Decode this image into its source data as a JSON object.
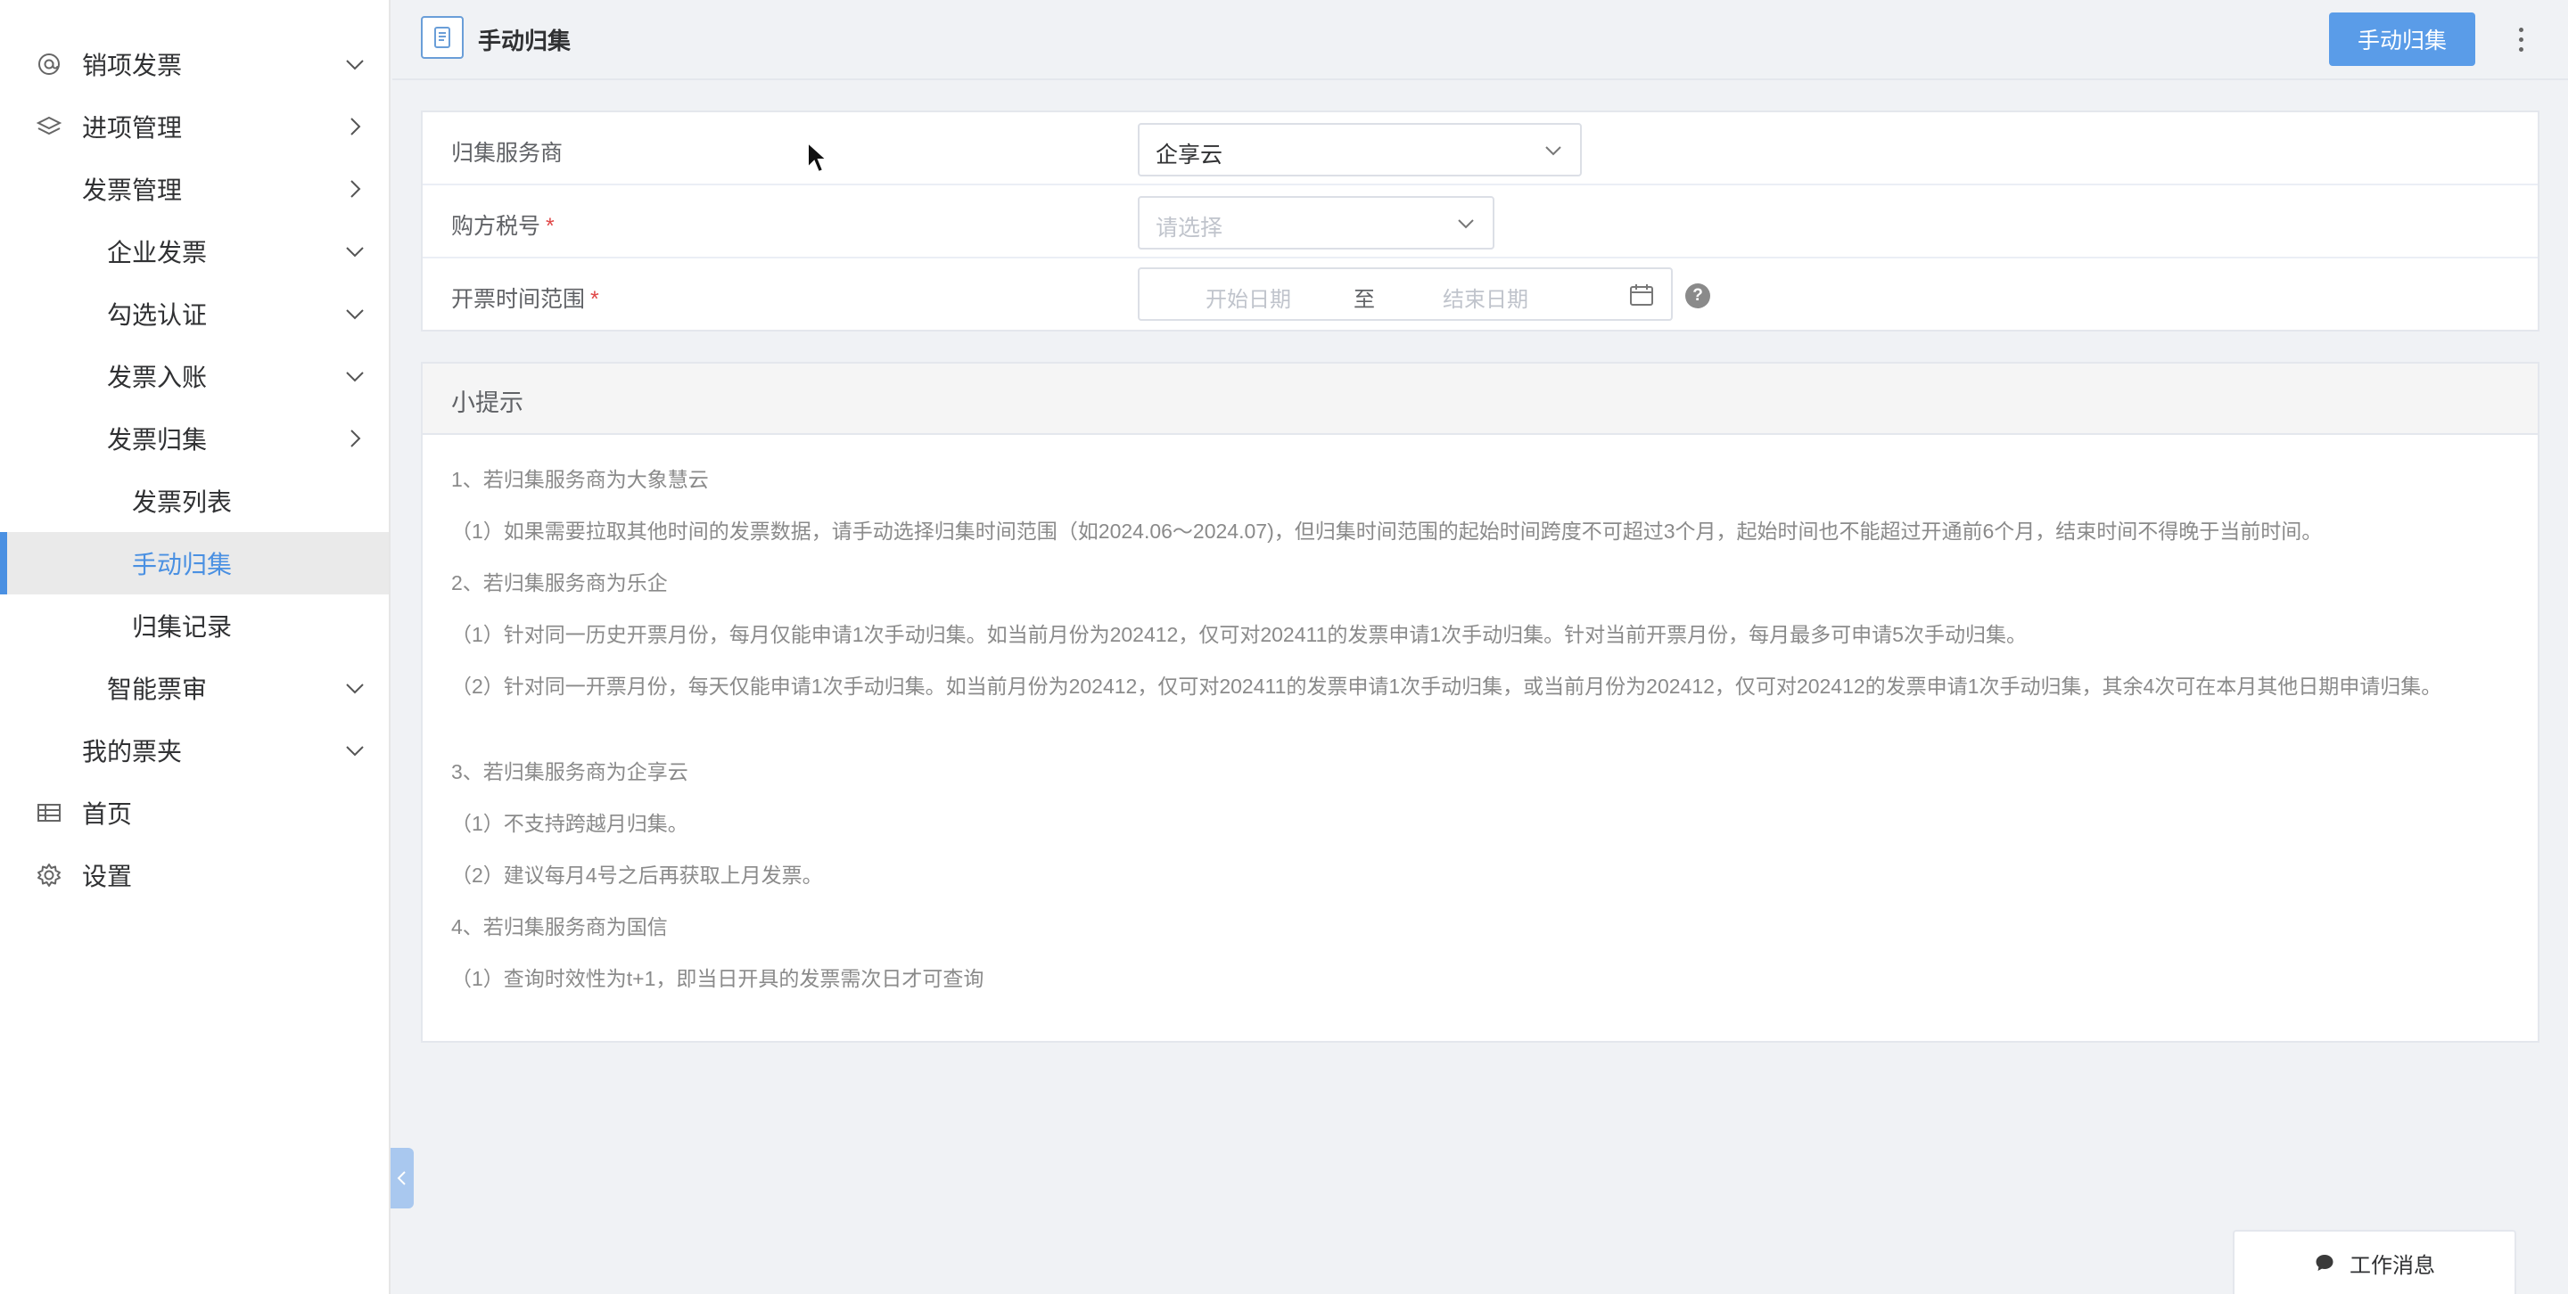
{
  "sidebar": {
    "items": [
      {
        "label": "销项发票",
        "icon": "at-icon",
        "arrow": "down"
      },
      {
        "label": "进项管理",
        "icon": "layers-icon",
        "arrow": "right"
      },
      {
        "label": "发票管理",
        "arrow": "right"
      },
      {
        "label": "企业发票",
        "arrow": "down"
      },
      {
        "label": "勾选认证",
        "arrow": "down"
      },
      {
        "label": "发票入账",
        "arrow": "down"
      },
      {
        "label": "发票归集",
        "arrow": "right"
      },
      {
        "label": "发票列表"
      },
      {
        "label": "手动归集",
        "active": true
      },
      {
        "label": "归集记录"
      },
      {
        "label": "智能票审",
        "arrow": "down"
      },
      {
        "label": "我的票夹",
        "arrow": "down"
      },
      {
        "label": "首页",
        "icon": "table-icon"
      },
      {
        "label": "设置",
        "icon": "gear-icon"
      }
    ]
  },
  "header": {
    "title": "手动归集",
    "primary_button": "手动归集"
  },
  "form": {
    "provider": {
      "label": "归集服务商",
      "value": "企享云"
    },
    "buyer_tax": {
      "label": "购方税号",
      "required_mark": "*",
      "placeholder": "请选择"
    },
    "date_range": {
      "label": "开票时间范围",
      "required_mark": "*",
      "start_placeholder": "开始日期",
      "separator": "至",
      "end_placeholder": "结束日期",
      "help": "?"
    }
  },
  "tips": {
    "title": "小提示",
    "lines": [
      "1、若归集服务商为大象慧云",
      "（1）如果需要拉取其他时间的发票数据，请手动选择归集时间范围（如2024.06～2024.07)，但归集时间范围的起始时间跨度不可超过3个月，起始时间也不能超过开通前6个月，结束时间不得晚于当前时间。",
      "2、若归集服务商为乐企",
      "（1）针对同一历史开票月份，每月仅能申请1次手动归集。如当前月份为202412，仅可对202411的发票申请1次手动归集。针对当前开票月份，每月最多可申请5次手动归集。",
      "（2）针对同一开票月份，每天仅能申请1次手动归集。如当前月份为202412，仅可对202411的发票申请1次手动归集，或当前月份为202412，仅可对202412的发票申请1次手动归集，其余4次可在本月其他日期申请归集。",
      "3、若归集服务商为企享云",
      "（1）不支持跨越月归集。",
      "（2）建议每月4号之后再获取上月发票。",
      "4、若归集服务商为国信",
      "（1）查询时效性为t+1，即当日开具的发票需次日才可查询"
    ]
  },
  "work_message": "工作消息",
  "colors": {
    "accent": "#4a90e2",
    "primary_button": "#5a9ce8",
    "required": "#e04848"
  }
}
